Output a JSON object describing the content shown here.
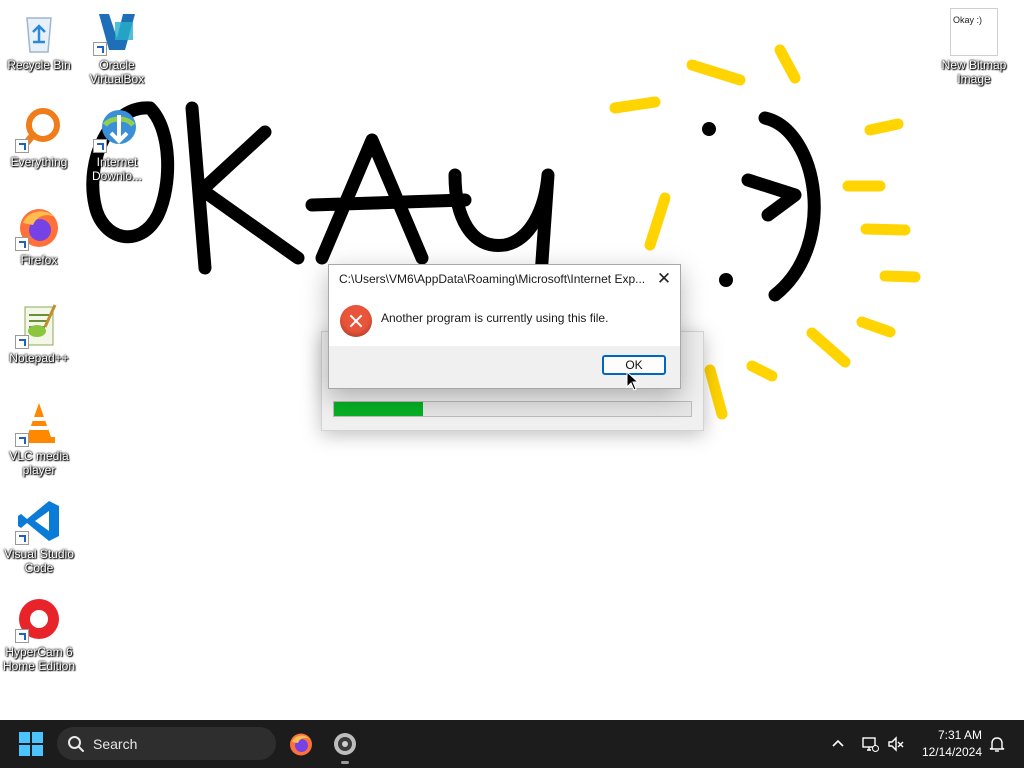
{
  "desktop": {
    "icons": [
      {
        "label": "Recycle Bin",
        "icon": "recycle-bin-icon"
      },
      {
        "label": "Oracle VirtualBox",
        "icon": "virtualbox-icon"
      },
      {
        "label": "Everything",
        "icon": "everything-search-icon"
      },
      {
        "label": "Internet Downlo...",
        "icon": "internet-download-manager-icon"
      },
      {
        "label": "Firefox",
        "icon": "firefox-icon"
      },
      {
        "label": "Notepad++",
        "icon": "notepadpp-icon"
      },
      {
        "label": "VLC media player",
        "icon": "vlc-icon"
      },
      {
        "label": "Visual Studio Code",
        "icon": "vscode-icon"
      },
      {
        "label": "HyperCam 6 Home Edition",
        "icon": "hypercam-icon"
      },
      {
        "label": "New Bitmap Image",
        "icon": "bitmap-image-icon"
      }
    ],
    "bitmap_thumb_text": "Okay :)",
    "wallpaper_text": "OKAY"
  },
  "progress_window": {
    "progress_percent": 25
  },
  "error_dialog": {
    "title": "C:\\Users\\VM6\\AppData\\Roaming\\Microsoft\\Internet Exp...",
    "message": "Another program is currently using this file.",
    "ok_label": "OK",
    "close_glyph": "✕"
  },
  "taskbar": {
    "search_label": "Search",
    "time": "7:31 AM",
    "date": "12/14/2024",
    "accent": "#4cc2ff"
  }
}
